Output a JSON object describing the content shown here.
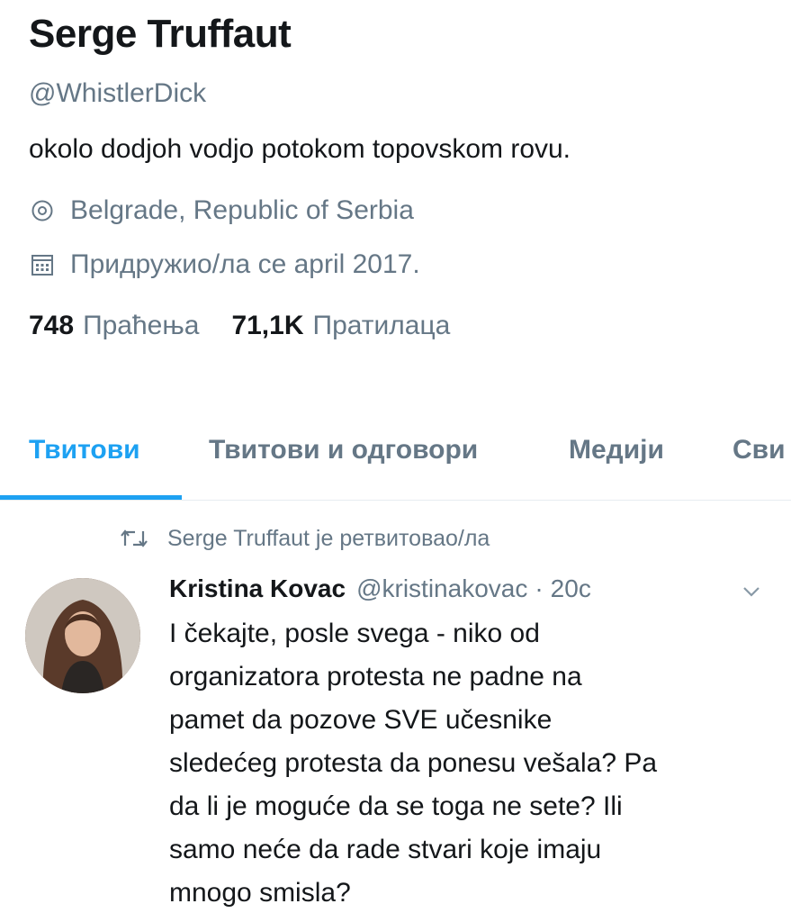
{
  "profile": {
    "name": "Serge Truffaut",
    "handle": "@WhistlerDick",
    "bio": "okolo dodjoh vodjo potokom topovskom rovu.",
    "location": "Belgrade, Republic of Serbia",
    "location_icon": "location-pin-icon",
    "joined": "Придружио/ла се april 2017.",
    "joined_icon": "calendar-icon",
    "following_count": "748",
    "following_label": "Праћења",
    "followers_count": "71,1K",
    "followers_label": "Пратилаца"
  },
  "tabs": [
    {
      "label": "Твитови",
      "active": true
    },
    {
      "label": "Твитови и одговори",
      "active": false
    },
    {
      "label": "Медији",
      "active": false
    },
    {
      "label": "Сви",
      "active": false
    }
  ],
  "tweet": {
    "retweet_text": "Serge Truffaut je ретвитовао/ла",
    "retweet_icon": "retweet-icon",
    "author": "Kristina Kovac",
    "author_handle": "@kristinakovac",
    "separator": "·",
    "time": "20с",
    "menu_icon": "chevron-down-icon",
    "text": "I čekajte, posle svega - niko od\norganizatora protesta ne padne na\npamet da pozove SVE učesnike\nsledećeg protesta da ponesu vešala? Pa\nda li je moguće da se toga ne sete? Ili\nsamo neće da rade stvari koje imaju\nmnogo smisla?"
  },
  "colors": {
    "accent": "#1da1f2",
    "text_primary": "#14171a",
    "text_secondary": "#657786",
    "divider": "#e6ecf0"
  }
}
